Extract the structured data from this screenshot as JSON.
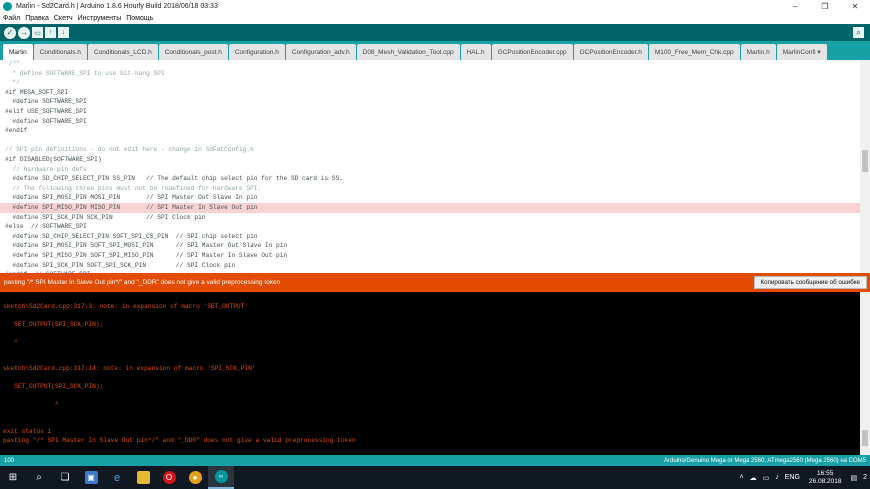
{
  "window": {
    "title": "Marlin - Sd2Card.h | Arduino 1.8.6 Hourly Build 2018/06/18 03:33",
    "minimize": "–",
    "maximize": "❐",
    "close": "✕"
  },
  "menu": [
    "Файл",
    "Правка",
    "Скетч",
    "Инструменты",
    "Помощь"
  ],
  "tabs": [
    {
      "label": "Marlin",
      "active": true
    },
    {
      "label": "Conditionals.h",
      "active": false
    },
    {
      "label": "Conditionals_LCD.h",
      "active": false
    },
    {
      "label": "Conditionals_post.h",
      "active": false
    },
    {
      "label": "Configuration.h",
      "active": false
    },
    {
      "label": "Configuration_adv.h",
      "active": false
    },
    {
      "label": "D08_Mesh_Validation_Tool.cpp",
      "active": false
    },
    {
      "label": "HAL.h",
      "active": false
    },
    {
      "label": "GCPositionEncoder.cpp",
      "active": false
    },
    {
      "label": "GCPositionEncoder.h",
      "active": false
    },
    {
      "label": "M100_Free_Mem_Chk.cpp",
      "active": false
    },
    {
      "label": "Marlin.h",
      "active": false
    },
    {
      "label": "MarlinConfi ▾",
      "active": false
    }
  ],
  "code": [
    {
      "text": " /**",
      "type": "comment"
    },
    {
      "text": "  * define SOFTWARE_SPI to use bit-bang SPI",
      "type": "comment"
    },
    {
      "text": "  */",
      "type": "comment"
    },
    {
      "text": "#if MEGA_SOFT_SPI",
      "type": "code"
    },
    {
      "text": "  #define SOFTWARE_SPI",
      "type": "code"
    },
    {
      "text": "#elif USE_SOFTWARE_SPI",
      "type": "code"
    },
    {
      "text": "  #define SOFTWARE_SPI",
      "type": "code"
    },
    {
      "text": "#endif",
      "type": "code"
    },
    {
      "text": "",
      "type": "code"
    },
    {
      "text": "// SPI pin definitions - do not edit here - change in SdFatConfig.h",
      "type": "comment"
    },
    {
      "text": "#if DISABLED(SOFTWARE_SPI)",
      "type": "code"
    },
    {
      "text": "  // hardware pin defs",
      "type": "comment"
    },
    {
      "text": "  #define SD_CHIP_SELECT_PIN SS_PIN   // The default chip select pin for the SD card is SS.",
      "type": "code"
    },
    {
      "text": "  // The following three pins must not be redefined for hardware SPI.",
      "type": "comment"
    },
    {
      "text": "  #define SPI_MOSI_PIN MOSI_PIN       // SPI Master Out Slave In pin",
      "type": "code"
    },
    {
      "text": "  #define SPI_MISO_PIN MISO_PIN       // SPI Master In Slave Out pin",
      "type": "code",
      "highlight": true
    },
    {
      "text": "  #define SPI_SCK_PIN SCK_PIN         // SPI Clock pin",
      "type": "code"
    },
    {
      "text": "#else  // SOFTWARE_SPI",
      "type": "code"
    },
    {
      "text": "  #define SD_CHIP_SELECT_PIN SOFT_SPI_CS_PIN  // SPI chip select pin",
      "type": "code"
    },
    {
      "text": "  #define SPI_MOSI_PIN SOFT_SPI_MOSI_PIN      // SPI Master Out Slave In pin",
      "type": "code"
    },
    {
      "text": "  #define SPI_MISO_PIN SOFT_SPI_MISO_PIN      // SPI Master In Slave Out pin",
      "type": "code"
    },
    {
      "text": "  #define SPI_SCK_PIN SOFT_SPI_SCK_PIN        // SPI Clock pin",
      "type": "code"
    },
    {
      "text": "#endif  // SOFTWARE_SPI",
      "type": "code"
    }
  ],
  "error_bar": {
    "message": "pasting \"/* SPI Master In Slave Out pin*/\" and \"_DDR\" does not give a valid preprocessing token",
    "copy_button": "Копировать сообщение об ошибке"
  },
  "console": [
    {
      "text": "sketch\\Sd2Card.cpp:317:3: note: in expansion of macro 'SET_OUTPUT'"
    },
    {
      "text": ""
    },
    {
      "text": "   SET_OUTPUT(SPI_SCK_PIN);"
    },
    {
      "text": ""
    },
    {
      "text": "   ^"
    },
    {
      "text": ""
    },
    {
      "text": ""
    },
    {
      "text": "sketch\\Sd2Card.cpp:317:14: note: in expansion of macro 'SPI_SCK_PIN'"
    },
    {
      "text": ""
    },
    {
      "text": "   SET_OUTPUT(SPI_SCK_PIN);"
    },
    {
      "text": ""
    },
    {
      "text": "              ^"
    },
    {
      "text": ""
    },
    {
      "text": ""
    },
    {
      "text": "exit status 1"
    },
    {
      "text": "pasting \"/* SPI Master In Slave Out pin*/\" and \"_DDR\" does not give a valid preprocessing token"
    }
  ],
  "status": {
    "line_number": "100",
    "board": "Arduino/Genuino Mega or Mega 2560, ATmega2560 (Mega 2560) на COM5"
  },
  "taskbar": {
    "language": "ENG",
    "time": "16:55",
    "date": "26.08.2018",
    "notifications": "2"
  },
  "colors": {
    "toolbar": "#006468",
    "tabbar": "#17a1a5",
    "error": "#e34c00",
    "highlight": "#f8d1d2",
    "console_bg": "#000000"
  }
}
